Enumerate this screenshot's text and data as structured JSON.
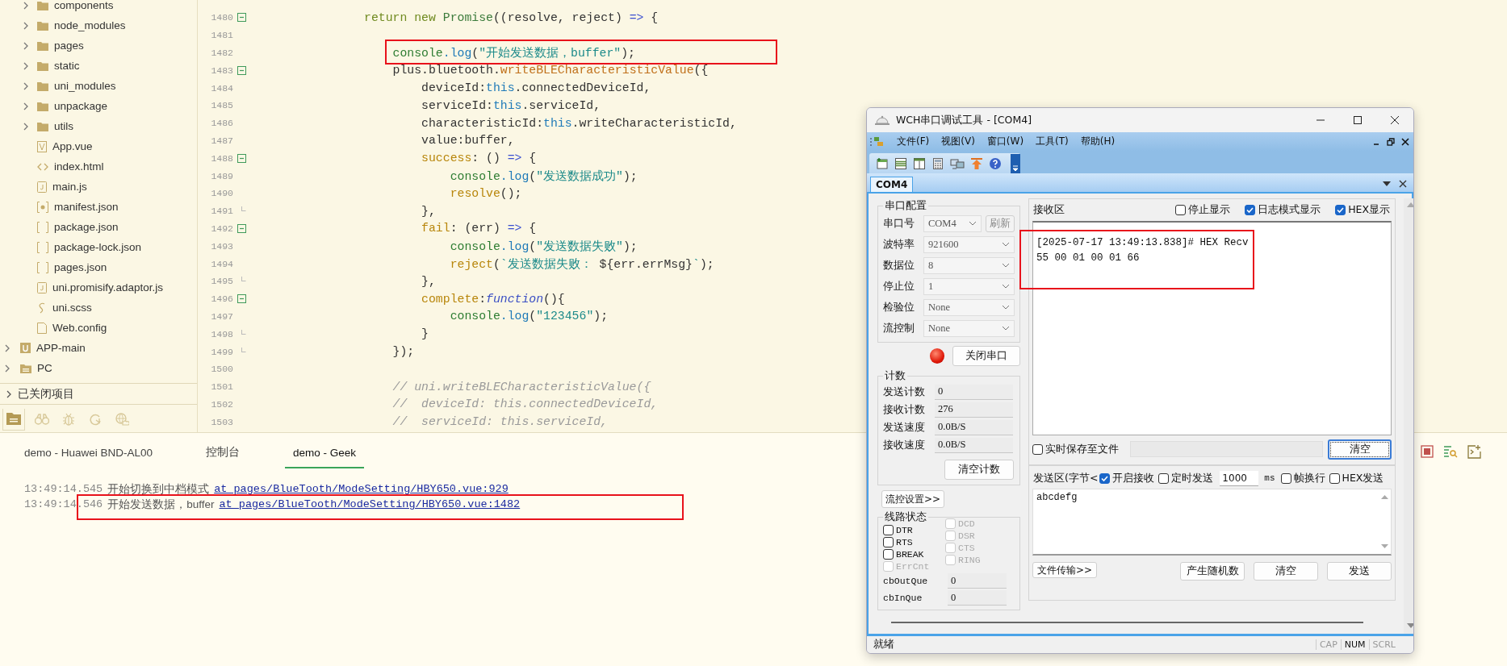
{
  "explorer": {
    "project_files": [
      {
        "label": "components",
        "kind": "folder",
        "expanded": false
      },
      {
        "label": "node_modules",
        "kind": "folder",
        "expanded": false
      },
      {
        "label": "pages",
        "kind": "folder",
        "expanded": false
      },
      {
        "label": "static",
        "kind": "folder",
        "expanded": false
      },
      {
        "label": "uni_modules",
        "kind": "folder",
        "expanded": false
      },
      {
        "label": "unpackage",
        "kind": "folder",
        "expanded": false
      },
      {
        "label": "utils",
        "kind": "folder",
        "expanded": false
      },
      {
        "label": "App.vue",
        "kind": "vue"
      },
      {
        "label": "index.html",
        "kind": "html"
      },
      {
        "label": "main.js",
        "kind": "js"
      },
      {
        "label": "manifest.json",
        "kind": "manifest"
      },
      {
        "label": "package.json",
        "kind": "json"
      },
      {
        "label": "package-lock.json",
        "kind": "json"
      },
      {
        "label": "pages.json",
        "kind": "json"
      },
      {
        "label": "uni.promisify.adaptor.js",
        "kind": "js"
      },
      {
        "label": "uni.scss",
        "kind": "scss"
      },
      {
        "label": "Web.config",
        "kind": "file"
      }
    ],
    "projects": [
      {
        "label": "APP-main",
        "kind": "uni",
        "expanded": false
      },
      {
        "label": "PC",
        "kind": "folder",
        "expanded": false
      }
    ],
    "closed_projects": {
      "label": "已关闭项目",
      "expanded": false
    },
    "bottom_tabs": [
      {
        "kind": "files",
        "selected": true
      },
      {
        "kind": "binoculars",
        "selected": false
      },
      {
        "kind": "bug",
        "selected": false
      },
      {
        "kind": "refresh",
        "selected": false
      },
      {
        "kind": "globe",
        "selected": false
      }
    ]
  },
  "editor": {
    "lines": [
      {
        "number": "1480",
        "kind": "fold-start",
        "highlighted": false,
        "code": [
          {
            "text": "                return",
            "kind": "keyword"
          },
          {
            "text": " new",
            "kind": "keyword"
          },
          {
            "text": " Promise",
            "kind": "class"
          },
          {
            "text": "((resolve, reject) ",
            "kind": "plain"
          },
          {
            "text": "=>",
            "kind": "operator"
          },
          {
            "text": " {",
            "kind": "plain"
          }
        ]
      },
      {
        "number": "1481",
        "kind": "plain",
        "highlighted": false
      },
      {
        "number": "1482",
        "kind": "plain",
        "highlighted": true,
        "code": [
          {
            "text": "                    console",
            "kind": "object"
          },
          {
            "text": ".log",
            "kind": "method"
          },
          {
            "text": "(",
            "kind": "plain"
          },
          {
            "text": "\"开始发送数据，buffer\"",
            "kind": "string"
          },
          {
            "text": ");",
            "kind": "plain"
          }
        ]
      },
      {
        "number": "1483",
        "kind": "fold-start",
        "highlighted": false,
        "code": [
          {
            "text": "                    plus.bluetooth.",
            "kind": "plain"
          },
          {
            "text": "writeBLECharacteristicValue",
            "kind": "function"
          },
          {
            "text": "({",
            "kind": "plain"
          }
        ]
      },
      {
        "number": "1484",
        "kind": "plain",
        "highlighted": false,
        "code": [
          {
            "text": "                        deviceId:",
            "kind": "plain"
          },
          {
            "text": "this",
            "kind": "this"
          },
          {
            "text": ".connectedDeviceId,",
            "kind": "plain"
          }
        ]
      },
      {
        "number": "1485",
        "kind": "plain",
        "highlighted": false,
        "code": [
          {
            "text": "                        serviceId:",
            "kind": "plain"
          },
          {
            "text": "this",
            "kind": "this"
          },
          {
            "text": ".serviceId,",
            "kind": "plain"
          }
        ]
      },
      {
        "number": "1486",
        "kind": "plain",
        "highlighted": false,
        "code": [
          {
            "text": "                        characteristicId:",
            "kind": "plain"
          },
          {
            "text": "this",
            "kind": "this"
          },
          {
            "text": ".writeCharacteristicId,",
            "kind": "plain"
          }
        ]
      },
      {
        "number": "1487",
        "kind": "plain",
        "highlighted": false,
        "code": [
          {
            "text": "                        value:buffer,",
            "kind": "plain"
          }
        ]
      },
      {
        "number": "1488",
        "kind": "fold-start",
        "highlighted": false,
        "code": [
          {
            "text": "                        success",
            "kind": "key"
          },
          {
            "text": ": () ",
            "kind": "plain"
          },
          {
            "text": "=>",
            "kind": "operator"
          },
          {
            "text": " {",
            "kind": "plain"
          }
        ]
      },
      {
        "number": "1489",
        "kind": "plain",
        "highlighted": false,
        "code": [
          {
            "text": "                            console",
            "kind": "object"
          },
          {
            "text": ".log",
            "kind": "method"
          },
          {
            "text": "(",
            "kind": "plain"
          },
          {
            "text": "\"发送数据成功\"",
            "kind": "string"
          },
          {
            "text": ");",
            "kind": "plain"
          }
        ]
      },
      {
        "number": "1490",
        "kind": "plain",
        "highlighted": false,
        "code": [
          {
            "text": "                            resolve",
            "kind": "key"
          },
          {
            "text": "();",
            "kind": "plain"
          }
        ]
      },
      {
        "number": "1491",
        "kind": "fold-end",
        "highlighted": false,
        "code": [
          {
            "text": "                        },",
            "kind": "plain"
          }
        ]
      },
      {
        "number": "1492",
        "kind": "fold-start",
        "highlighted": false,
        "code": [
          {
            "text": "                        fail",
            "kind": "key"
          },
          {
            "text": ": (err) ",
            "kind": "plain"
          },
          {
            "text": "=>",
            "kind": "operator"
          },
          {
            "text": " {",
            "kind": "plain"
          }
        ]
      },
      {
        "number": "1493",
        "kind": "plain",
        "highlighted": false,
        "code": [
          {
            "text": "                            console",
            "kind": "object"
          },
          {
            "text": ".log",
            "kind": "method"
          },
          {
            "text": "(",
            "kind": "plain"
          },
          {
            "text": "\"发送数据失败\"",
            "kind": "string"
          },
          {
            "text": ");",
            "kind": "plain"
          }
        ]
      },
      {
        "number": "1494",
        "kind": "plain",
        "highlighted": false,
        "code": [
          {
            "text": "                            reject",
            "kind": "key"
          },
          {
            "text": "(",
            "kind": "plain"
          },
          {
            "text": "`发送数据失败：",
            "kind": "string"
          },
          {
            "text": " ${err.errMsg}",
            "kind": "plain"
          },
          {
            "text": "`",
            "kind": "string"
          },
          {
            "text": ");",
            "kind": "plain"
          }
        ]
      },
      {
        "number": "1495",
        "kind": "fold-end",
        "highlighted": false,
        "code": [
          {
            "text": "                        },",
            "kind": "plain"
          }
        ]
      },
      {
        "number": "1496",
        "kind": "fold-start",
        "highlighted": false,
        "code": [
          {
            "text": "                        complete",
            "kind": "key"
          },
          {
            "text": ":",
            "kind": "plain"
          },
          {
            "text": "function",
            "kind": "italic"
          },
          {
            "text": "(){",
            "kind": "plain"
          }
        ]
      },
      {
        "number": "1497",
        "kind": "plain",
        "highlighted": false,
        "code": [
          {
            "text": "                            console",
            "kind": "object"
          },
          {
            "text": ".log",
            "kind": "method"
          },
          {
            "text": "(",
            "kind": "plain"
          },
          {
            "text": "\"123456\"",
            "kind": "string"
          },
          {
            "text": ");",
            "kind": "plain"
          }
        ]
      },
      {
        "number": "1498",
        "kind": "fold-end",
        "highlighted": false,
        "code": [
          {
            "text": "                        }",
            "kind": "plain"
          }
        ]
      },
      {
        "number": "1499",
        "kind": "fold-end",
        "highlighted": false,
        "code": [
          {
            "text": "                    });",
            "kind": "plain"
          }
        ]
      },
      {
        "number": "1500",
        "kind": "plain",
        "highlighted": false
      },
      {
        "number": "1501",
        "kind": "plain",
        "highlighted": false,
        "code": [
          {
            "text": "                    // uni.writeBLECharacteristicValue({",
            "kind": "comment"
          }
        ]
      },
      {
        "number": "1502",
        "kind": "plain",
        "highlighted": false,
        "code": [
          {
            "text": "                    //  deviceId: this.connectedDeviceId,",
            "kind": "comment"
          }
        ]
      },
      {
        "number": "1503",
        "kind": "plain",
        "highlighted": false,
        "code": [
          {
            "text": "                    //  serviceId: this.serviceId,",
            "kind": "comment"
          }
        ]
      }
    ]
  },
  "console": {
    "tabs": [
      {
        "label": "demo - Huawei BND-AL00",
        "selected": false
      },
      {
        "label": "控制台",
        "selected": false
      },
      {
        "label": "demo - Geek",
        "selected": true
      }
    ],
    "lines": [
      {
        "time": "13:49:14.545",
        "message": "开始切换到中档模式",
        "link": "at pages/BlueTooth/ModeSetting/HBY650.vue:929",
        "highlighted": false
      },
      {
        "time": "13:49:14.546",
        "message": "开始发送数据，buffer",
        "link": "at pages/BlueTooth/ModeSetting/HBY650.vue:1482",
        "highlighted": true
      }
    ]
  },
  "serial_tool": {
    "title": "WCH串口调试工具 - [COM4]",
    "menu": [
      "文件(F)",
      "视图(V)",
      "窗口(W)",
      "工具(T)",
      "帮助(H)"
    ],
    "doc_tab": "COM4",
    "port_config": {
      "title": "串口配置",
      "fields": [
        {
          "label": "串口号",
          "value": "COM4",
          "button": "刷新"
        },
        {
          "label": "波特率",
          "value": "921600"
        },
        {
          "label": "数据位",
          "value": "8"
        },
        {
          "label": "停止位",
          "value": "1"
        },
        {
          "label": "检验位",
          "value": "None"
        },
        {
          "label": "流控制",
          "value": "None"
        }
      ],
      "port_open": true,
      "toggle_button": "关闭串口"
    },
    "counters": {
      "title": "计数",
      "rows": [
        {
          "label": "发送计数",
          "value": "0"
        },
        {
          "label": "接收计数",
          "value": "276"
        },
        {
          "label": "发送速度",
          "value": "0.0B/S"
        },
        {
          "label": "接收速度",
          "value": "0.0B/S"
        }
      ],
      "reset_button": "清空计数"
    },
    "flow_button": "流控设置>>",
    "line_status": {
      "title": "线路状态",
      "outputs": [
        {
          "label": "DTR",
          "checked": false,
          "disabled": false
        },
        {
          "label": "RTS",
          "checked": false,
          "disabled": false
        },
        {
          "label": "BREAK",
          "checked": false,
          "disabled": false
        },
        {
          "label": "ErrCnt",
          "checked": false,
          "disabled": true
        }
      ],
      "inputs": [
        {
          "label": "DCD",
          "checked": false,
          "disabled": true
        },
        {
          "label": "DSR",
          "checked": false,
          "disabled": true
        },
        {
          "label": "CTS",
          "checked": false,
          "disabled": true
        },
        {
          "label": "RING",
          "checked": false,
          "disabled": true
        }
      ],
      "queues": [
        {
          "label": "cbOutQue",
          "value": "0"
        },
        {
          "label": "cbInQue",
          "value": "0"
        }
      ]
    },
    "receive": {
      "title": "接收区",
      "options": [
        {
          "label": "停止显示",
          "checked": false
        },
        {
          "label": "日志模式显示",
          "checked": true
        },
        {
          "label": "HEX显示",
          "checked": true
        }
      ],
      "lines": [
        "[2025-07-17 13:49:13.838]# HEX Recv",
        "55 00 01 00 01 66"
      ],
      "highlighted": true,
      "save_option": {
        "label": "实时保存至文件",
        "checked": false
      },
      "clear_button": "清空"
    },
    "send": {
      "title": "发送区(字节<",
      "options": [
        {
          "kind": "checkbox",
          "label": "开启接收",
          "checked": true
        },
        {
          "kind": "checkbox",
          "label": "定时发送",
          "checked": false
        },
        {
          "kind": "interval",
          "value": "1000",
          "unit": "ms"
        },
        {
          "kind": "checkbox",
          "label": "帧换行",
          "checked": false
        },
        {
          "kind": "checkbox",
          "label": "HEX发送",
          "checked": false
        }
      ],
      "text": "abcdefg",
      "buttons": [
        "文件传输>>",
        "产生随机数",
        "清空",
        "发送"
      ]
    },
    "status_bar": {
      "text": "就绪",
      "indicators": [
        {
          "label": "CAP",
          "on": false
        },
        {
          "label": "NUM",
          "on": true
        },
        {
          "label": "SCRL",
          "on": false
        }
      ]
    }
  }
}
